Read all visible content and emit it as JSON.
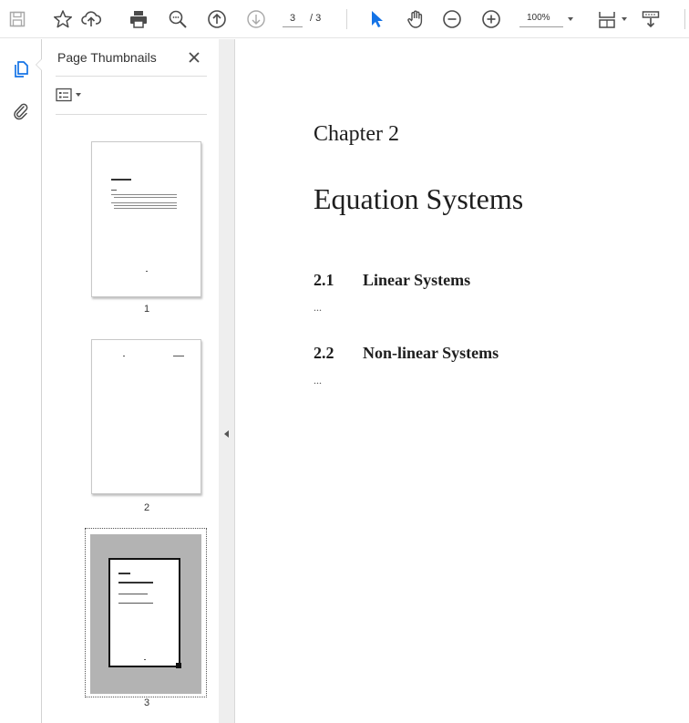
{
  "toolbar": {
    "page_current": "3",
    "page_total": "/ 3",
    "zoom": "100%",
    "icons": [
      "save-icon",
      "bookmark-star-icon",
      "cloud-upload-icon",
      "print-icon",
      "zoom-search-icon",
      "previous-page-icon",
      "next-page-icon",
      "select-arrow-icon",
      "hand-pan-icon",
      "zoom-out-icon",
      "zoom-in-icon",
      "fit-page-icon",
      "scroll-mode-icon"
    ]
  },
  "rail": {
    "icons": [
      "page-thumbnails-icon",
      "attachment-paperclip-icon"
    ]
  },
  "panel": {
    "title": "Page Thumbnails",
    "thumbnails": [
      {
        "label": "1",
        "selected": false
      },
      {
        "label": "2",
        "selected": false
      },
      {
        "label": "3",
        "selected": true
      }
    ]
  },
  "document": {
    "chapter": "Chapter 2",
    "title": "Equation Systems",
    "sections": [
      {
        "number": "2.1",
        "title": "Linear Systems",
        "body": "..."
      },
      {
        "number": "2.2",
        "title": "Non-linear Systems",
        "body": "..."
      }
    ]
  },
  "colors": {
    "accent_blue": "#1473e6",
    "icon_gray": "#4b4b4b",
    "disabled_gray": "#a8a8a8",
    "selected_thumb_bg": "#b3b3b3"
  }
}
